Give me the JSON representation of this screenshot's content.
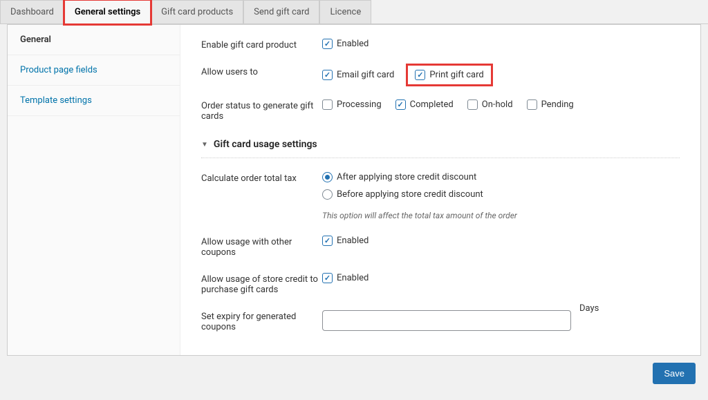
{
  "tabs": [
    {
      "label": "Dashboard"
    },
    {
      "label": "General settings"
    },
    {
      "label": "Gift card products"
    },
    {
      "label": "Send gift card"
    },
    {
      "label": "Licence"
    }
  ],
  "sidebar": [
    {
      "label": "General"
    },
    {
      "label": "Product page fields"
    },
    {
      "label": "Template settings"
    }
  ],
  "rows": {
    "enable_product": {
      "label": "Enable gift card product",
      "enabled": "Enabled"
    },
    "allow_users": {
      "label": "Allow users to",
      "email": "Email gift card",
      "print": "Print gift card"
    },
    "order_status": {
      "label": "Order status to generate gift cards",
      "processing": "Processing",
      "completed": "Completed",
      "onhold": "On-hold",
      "pending": "Pending"
    }
  },
  "section": {
    "title": "Gift card usage settings"
  },
  "usage": {
    "calc_tax": {
      "label": "Calculate order total tax",
      "after": "After applying store credit discount",
      "before": "Before applying store credit discount",
      "help": "This option will affect the total tax amount of the order"
    },
    "other_coupons": {
      "label": "Allow usage with other coupons",
      "enabled": "Enabled"
    },
    "store_credit": {
      "label": "Allow usage of store credit to purchase gift cards",
      "enabled": "Enabled"
    },
    "expiry": {
      "label": "Set expiry for generated coupons",
      "unit": "Days"
    }
  },
  "save": "Save"
}
